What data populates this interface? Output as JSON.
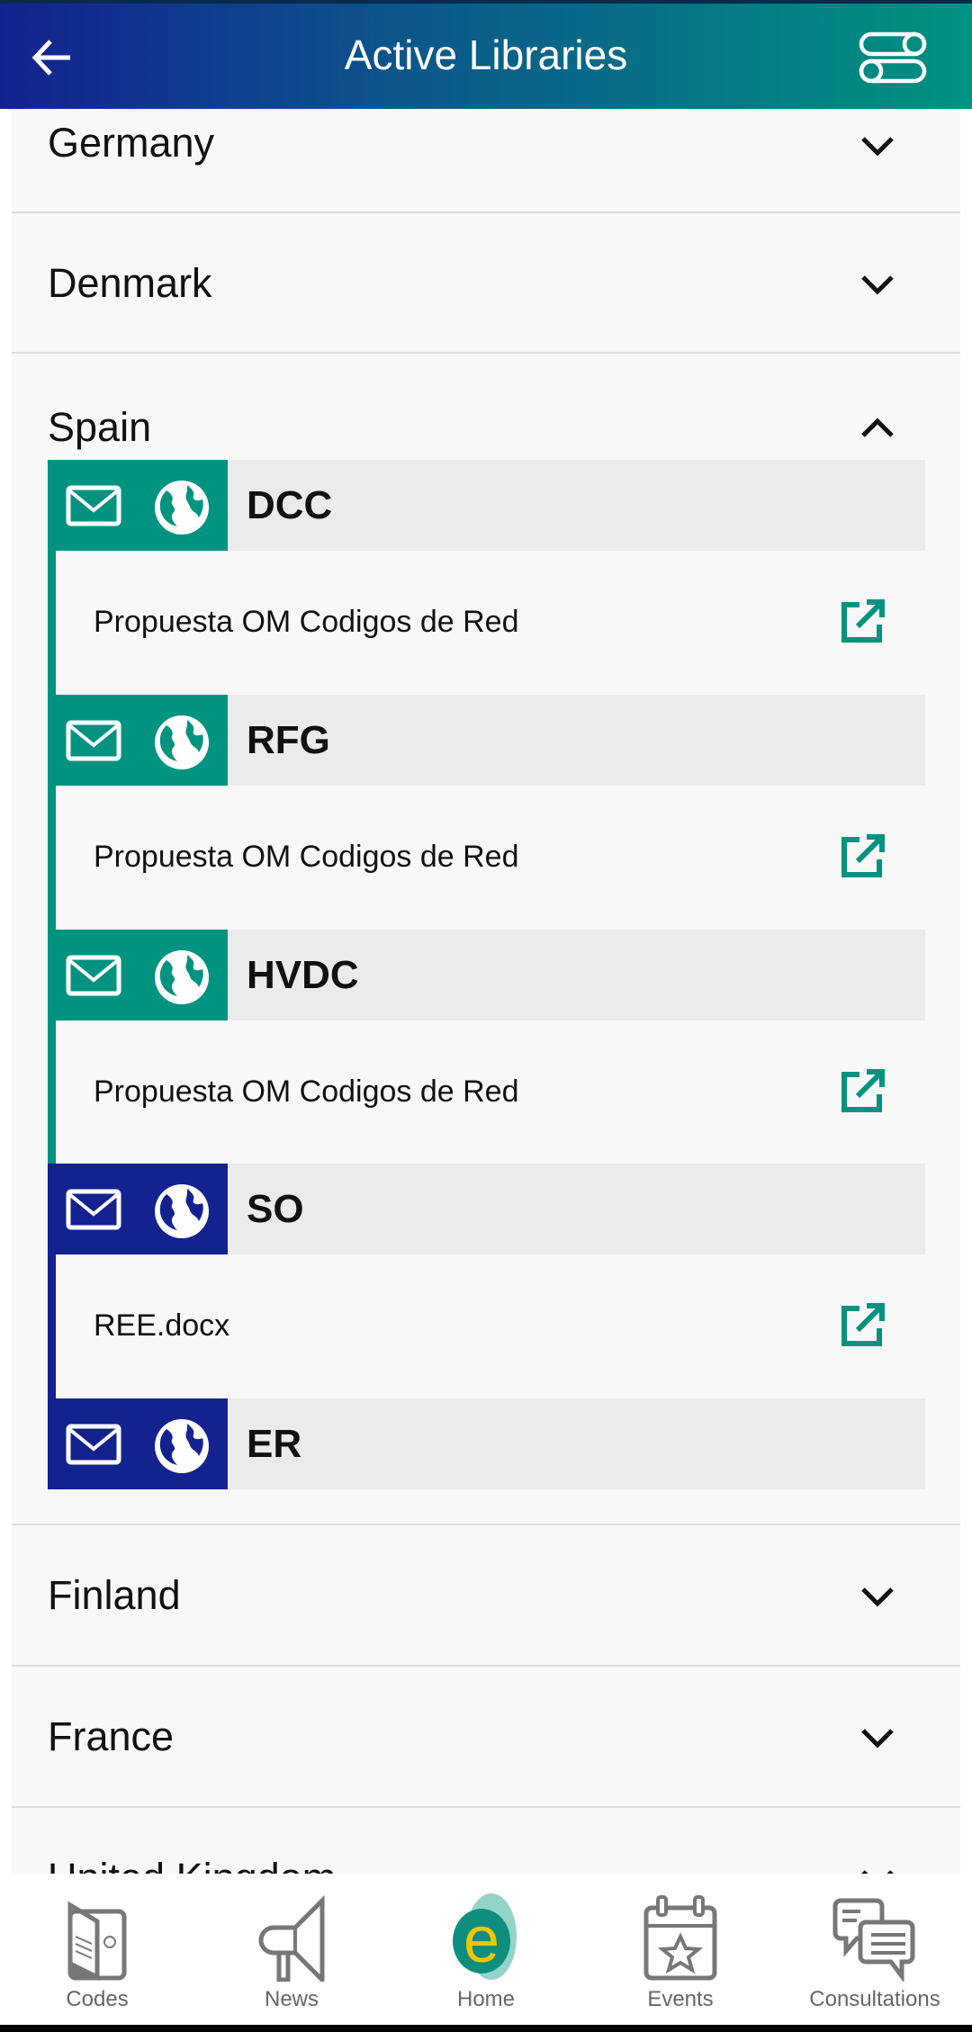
{
  "header": {
    "title": "Active Libraries",
    "back_icon": "arrow-left-icon",
    "filter_icon": "toggles-icon"
  },
  "colors": {
    "teal": "#009380",
    "navy": "#13228f",
    "subheader_bg": "#ebebeb"
  },
  "countries_top": [
    {
      "name": "Germany",
      "expanded": false
    },
    {
      "name": "Denmark",
      "expanded": false
    }
  ],
  "spain": {
    "name": "Spain",
    "expanded": true,
    "items": [
      {
        "code": "DCC",
        "color": "teal",
        "link": "Propuesta OM Codigos de Red"
      },
      {
        "code": "RFG",
        "color": "teal",
        "link": "Propuesta OM Codigos de Red"
      },
      {
        "code": "HVDC",
        "color": "teal",
        "link": "Propuesta OM Codigos de Red"
      },
      {
        "code": "SO",
        "color": "navy",
        "link": "REE.docx"
      },
      {
        "code": "ER",
        "color": "navy"
      }
    ]
  },
  "countries_bottom": [
    {
      "name": "Finland",
      "expanded": false
    },
    {
      "name": "France",
      "expanded": false
    },
    {
      "name": "United Kingdom",
      "expanded": false
    }
  ],
  "nav": [
    {
      "label": "Codes",
      "icon": "book-icon"
    },
    {
      "label": "News",
      "icon": "megaphone-icon"
    },
    {
      "label": "Home",
      "icon": "home-logo-icon",
      "active": true
    },
    {
      "label": "Events",
      "icon": "calendar-star-icon"
    },
    {
      "label": "Consultations",
      "icon": "chat-bubbles-icon"
    }
  ]
}
